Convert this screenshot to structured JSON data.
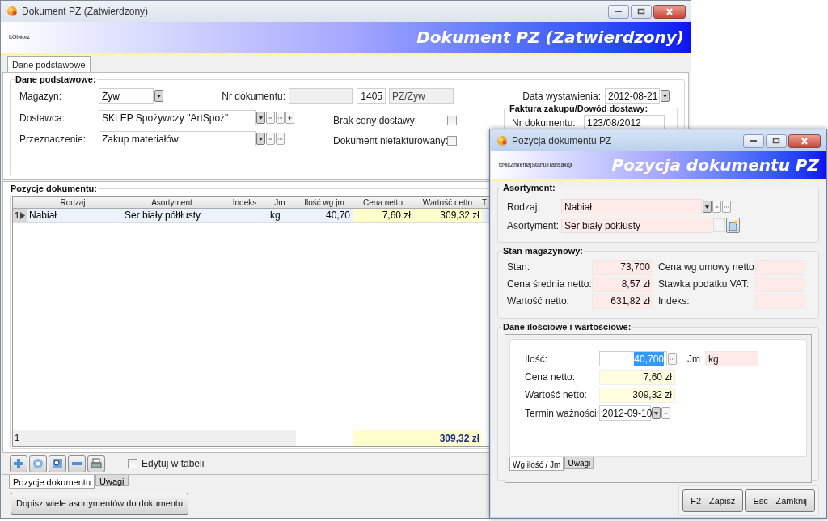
{
  "main_window": {
    "title": "Dokument PZ (Zatwierdzony)",
    "banner_caption": "ttOtworz",
    "banner_title": "Dokument PZ (Zatwierdzony)",
    "tabs": [
      {
        "label": "Dane podstawowe",
        "selected": true
      }
    ],
    "basic_group": {
      "title": "Dane podstawowe:",
      "magazyn": {
        "label": "Magazyn:",
        "value": "Żyw"
      },
      "nr_dokumentu": {
        "label": "Nr dokumentu:",
        "number": "1405",
        "series": "PZ/Żyw"
      },
      "data_wystawienia": {
        "label": "Data wystawienia:",
        "value": "2012-08-21"
      },
      "dostawca": {
        "label": "Dostawca:",
        "value": "SKLEP Spożywczy \"ArtSpoż\""
      },
      "przeznaczenie": {
        "label": "Przeznaczenie:",
        "value": "Zakup materiałów"
      },
      "checkboxes": [
        {
          "label": "Brak ceny dostawy:",
          "checked": false
        },
        {
          "label": "Dokument niefakturowany:",
          "checked": false
        }
      ],
      "invoice_group": {
        "title": "Faktura zakupu/Dowód dostawy:",
        "nr_dokumentu": {
          "label": "Nr dokumentu:",
          "value": "123/08/2012"
        }
      }
    },
    "positions": {
      "title": "Pozycje dokumentu:",
      "columns": [
        "Rodzaj",
        "Asortyment",
        "Indeks",
        "Jm",
        "Ilość wg jm",
        "Cena netto",
        "Wartość netto",
        "T"
      ],
      "rows": [
        {
          "number": "1",
          "selected": true,
          "rodzaj": "Nabiał",
          "asortyment": "Ser biały półtłusty",
          "jm": "kg",
          "ilosc": "40,70",
          "cena_netto": "7,60 zł",
          "wartosc_netto": "309,32 zł"
        }
      ],
      "footer": {
        "count": "1",
        "total": "309,32 zł"
      }
    },
    "edit_in_table": {
      "label": "Edytuj w tabeli",
      "checked": false
    },
    "bottom_tabs": [
      {
        "label": "Pozycje dokumentu",
        "selected": true
      },
      {
        "label": "Uwagi",
        "selected": false
      }
    ],
    "add_many_button": "Dopisz wiele asortymentów do dokumentu"
  },
  "dialog": {
    "title": "Pozycja dokumentu PZ",
    "banner_caption": "ttNicZmieniajStanuTransakcji",
    "banner_title": "Pozycja dokumentu PZ",
    "assortment_group": {
      "title": "Asortyment:",
      "rodzaj": {
        "label": "Rodzaj:",
        "value": "Nabiał"
      },
      "asortyment": {
        "label": "Asortyment:",
        "value": "Ser biały półtłusty"
      }
    },
    "stock_group": {
      "title": "Stan magazynowy:",
      "left": [
        {
          "label": "Stan:",
          "value": "73,700"
        },
        {
          "label": "Cena średnia netto:",
          "value": "8,57 zł"
        },
        {
          "label": "Wartość netto:",
          "value": "631,82 zł"
        }
      ],
      "right": [
        {
          "label": "Cena wg umowy netto:"
        },
        {
          "label": "Stawka podatku VAT:"
        },
        {
          "label": "Indeks:"
        }
      ]
    },
    "quantity_group": {
      "title": "Dane ilościowe i wartościowe:",
      "ilosc": {
        "label": "Ilość:",
        "value": "40,700",
        "focused": true
      },
      "jm": {
        "label": "Jm",
        "value": "kg"
      },
      "cena_netto": {
        "label": "Cena netto:",
        "value": "7,60 zł"
      },
      "wartosc_netto": {
        "label": "Wartość netto:",
        "value": "309,32 zł"
      },
      "termin": {
        "label": "Termin ważności:",
        "value": "2012-09-10"
      },
      "tabs": [
        {
          "label": "Wg ilość / Jm",
          "selected": true
        },
        {
          "label": "Uwagi",
          "selected": false
        }
      ]
    },
    "buttons": [
      "F2 - Zapisz",
      "Esc - Zamknij"
    ]
  }
}
